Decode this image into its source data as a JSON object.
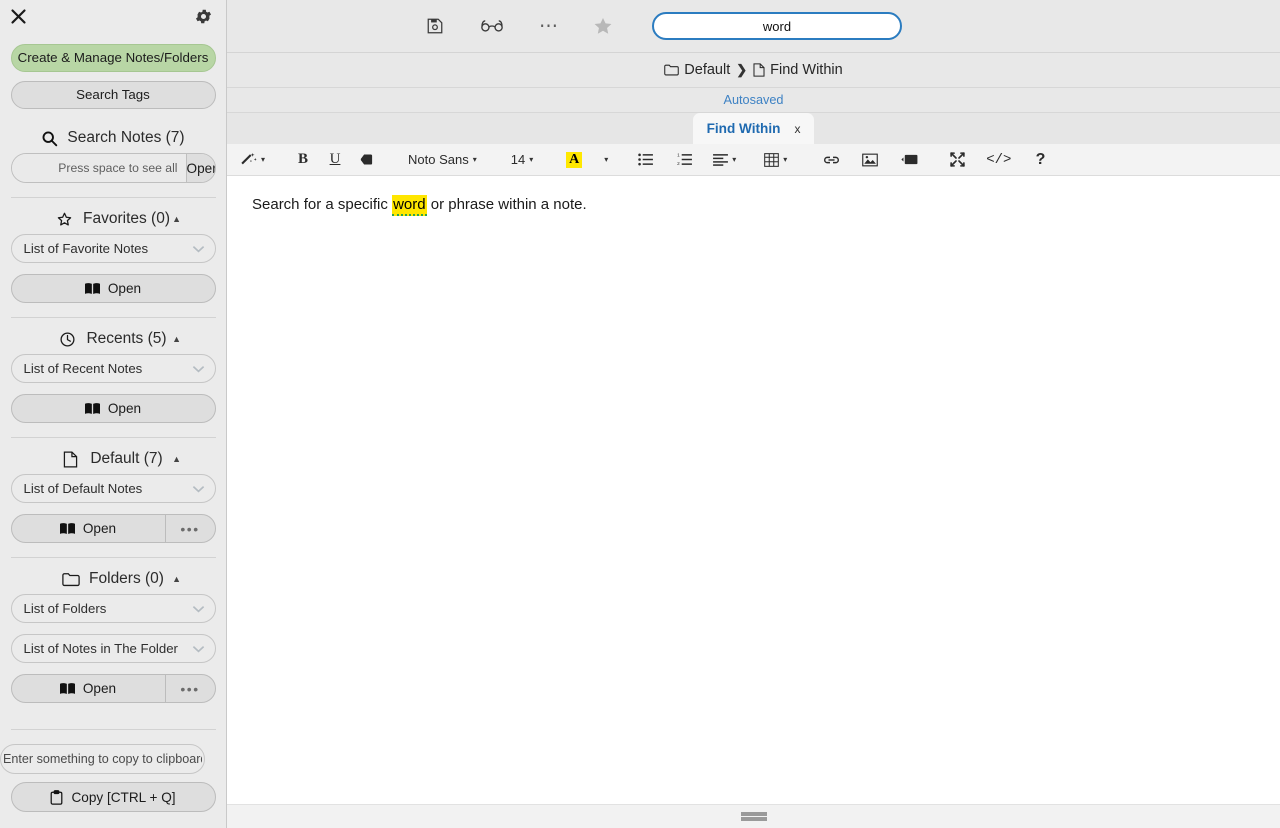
{
  "sidebar": {
    "close_label": "✕",
    "settings_icon": "gear-icon",
    "create_manage_label": "Create & Manage Notes/Folders",
    "search_tags_label": "Search Tags",
    "search_notes": {
      "title": "Search Notes (7)",
      "placeholder": "Press space to see all",
      "value": "",
      "open_label": "Open"
    },
    "sections": [
      {
        "key": "favorites",
        "icon": "star-icon",
        "title": "Favorites (0)",
        "caret": "▲",
        "select_label": "List of Favorite Notes",
        "open_label": "Open",
        "has_more": false
      },
      {
        "key": "recents",
        "icon": "clock-icon",
        "title": "Recents (5)",
        "caret": "▲",
        "select_label": "List of Recent Notes",
        "open_label": "Open",
        "has_more": false
      },
      {
        "key": "default",
        "icon": "file-icon",
        "title": "Default (7)",
        "caret": "▲",
        "select_label": "List of Default Notes",
        "open_label": "Open",
        "more_label": "•••",
        "has_more": true
      },
      {
        "key": "folders",
        "icon": "folder-icon",
        "title": "Folders (0)",
        "caret": "▲",
        "select_label": "List of Folders",
        "select_label_2": "List of Notes in The Folder",
        "open_label": "Open",
        "more_label": "•••",
        "has_more": true
      }
    ],
    "clipboard": {
      "placeholder": "Enter something to copy to clipboard",
      "value": "",
      "copy_label": "Copy [CTRL + Q]"
    }
  },
  "topbar": {
    "icons": [
      "save-icon",
      "reading-glasses-icon",
      "more-icon",
      "favorite-star-icon"
    ],
    "search": {
      "value": "word",
      "placeholder": "",
      "border_color": "#2b7cc0"
    }
  },
  "breadcrumb": {
    "folder": "Default",
    "separator": "❯",
    "note": "Find Within"
  },
  "status": {
    "autosaved": "Autosaved",
    "autosaved_color": "#3e82c4"
  },
  "tabs": [
    {
      "label": "Find Within",
      "close": "x",
      "active": true
    }
  ],
  "toolbar": {
    "magic_label": "magic-wand-icon",
    "bold_label": "B",
    "underline_label": "U",
    "eraser_label": "eraser-icon",
    "font_name": "Noto Sans",
    "font_size": "14",
    "text_color_label": "A",
    "text_color_highlight": "#ffe800",
    "bullet_list_label": "bullet-list-icon",
    "numbered_list_label": "numbered-list-icon",
    "align_label": "align-icon",
    "table_label": "table-icon",
    "link_label": "link-icon",
    "image_label": "image-icon",
    "video_label": "video-icon",
    "fullscreen_label": "fullscreen-icon",
    "code_label": "</>",
    "help_label": "?",
    "caret": "▾"
  },
  "editor": {
    "text_before": "Search for a specific ",
    "highlighted_word": "word",
    "text_after": " or phrase within a note.",
    "highlight_color": "#ffe600",
    "spellcheck_underline_color": "#2ea44f"
  },
  "bottom": {
    "resize_handle": "resize-grip"
  }
}
